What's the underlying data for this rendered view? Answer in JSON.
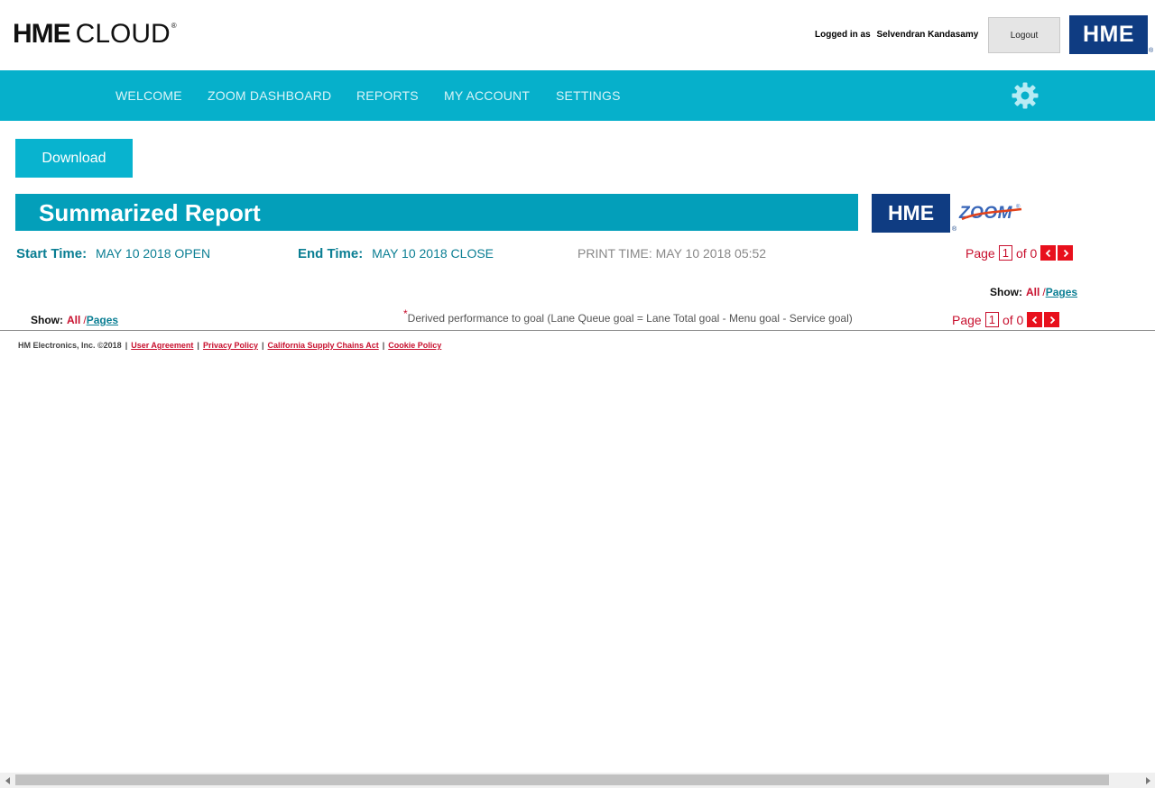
{
  "header": {
    "brand_bold": "HME",
    "brand_light": "CLOUD",
    "brand_reg": "®",
    "logged_in_label": "Logged in as",
    "user_name": "Selvendran Kandasamy",
    "logout_label": "Logout",
    "logo_text": "HME",
    "logo_reg": "®"
  },
  "nav": {
    "items": [
      {
        "label": "WELCOME"
      },
      {
        "label": "ZOOM DASHBOARD"
      },
      {
        "label": "REPORTS"
      },
      {
        "label": "MY ACCOUNT"
      },
      {
        "label": "SETTINGS"
      }
    ],
    "settings_icon": "gear-icon",
    "bg_color": "#06b0cb"
  },
  "report": {
    "download_label": "Download",
    "title": "Summarized Report",
    "logo_hme": "HME",
    "logo_hme_reg": "®",
    "logo_zoom": "ZOOM",
    "logo_zoom_reg": "®",
    "start_label": "Start Time:",
    "start_value": "MAY 10 2018 OPEN",
    "end_label": "End Time:",
    "end_value": "MAY 10 2018 CLOSE",
    "print_time": "PRINT TIME: MAY 10 2018 05:52"
  },
  "pager_top": {
    "page_label": "Page",
    "current_page": "1",
    "of_label": "of 0"
  },
  "show_top": {
    "label": "Show:",
    "all": "All",
    "sep": "/",
    "pages": "Pages"
  },
  "show_bottom": {
    "label": "Show:",
    "all": "All",
    "sep": "/",
    "pages": "Pages"
  },
  "derived_note": {
    "star": "*",
    "text": "Derived performance to goal (Lane Queue goal = Lane Total goal - Menu goal - Service goal)"
  },
  "pager_bottom": {
    "page_label": "Page",
    "current_page": "1",
    "of_label": "of 0"
  },
  "footer": {
    "copyright": "HM Electronics, Inc. ©2018",
    "links": [
      {
        "label": "User Agreement"
      },
      {
        "label": "Privacy Policy"
      },
      {
        "label": "California Supply Chains Act"
      },
      {
        "label": "Cookie Policy"
      }
    ]
  },
  "colors": {
    "accent": "#06b0cb",
    "banner": "#039fba",
    "brand_blue": "#0f3c82",
    "red": "#c8102e",
    "teal_text": "#0a7e93"
  }
}
